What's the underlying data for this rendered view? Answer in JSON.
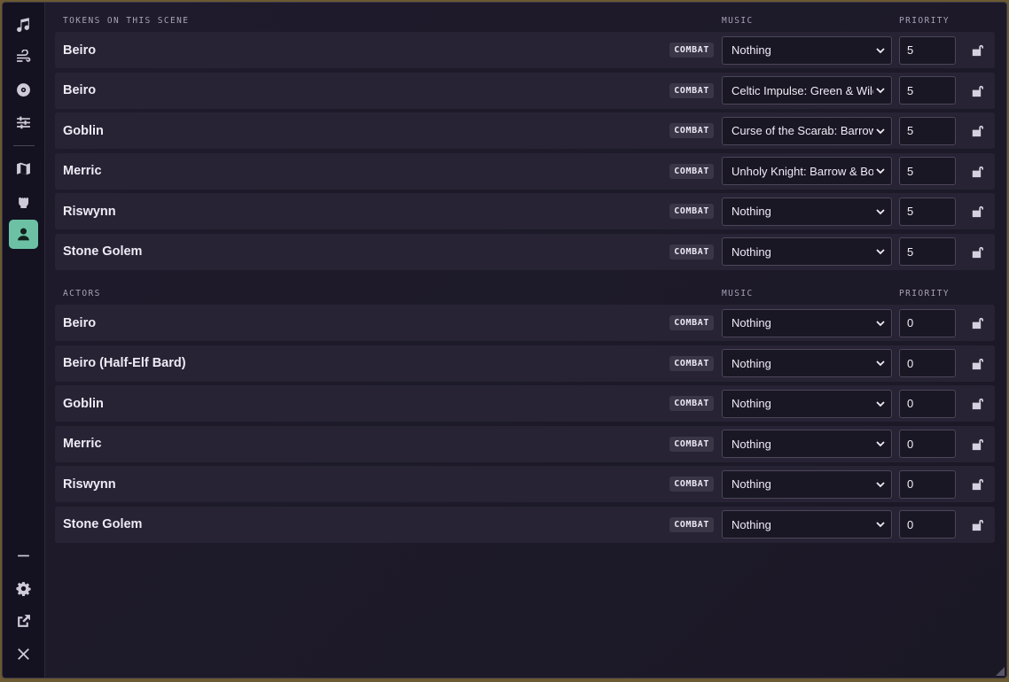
{
  "sidebar": {
    "top_icons": [
      "music-icon",
      "wind-icon",
      "vinyl-icon",
      "sliders-icon"
    ],
    "mid_icons": [
      "map-icon",
      "fist-icon",
      "user-icon"
    ],
    "active": "user-icon",
    "bottom_icons": [
      "minimize-icon",
      "gear-icon",
      "external-link-icon",
      "close-icon"
    ]
  },
  "sections": [
    {
      "title": "TOKENS ON THIS SCENE",
      "music_header": "MUSIC",
      "priority_header": "PRIORITY",
      "rows": [
        {
          "name": "Beiro",
          "badge": "COMBAT",
          "music": "Nothing",
          "priority": "5"
        },
        {
          "name": "Beiro",
          "badge": "COMBAT",
          "music": "Celtic Impulse: Green & Wild",
          "priority": "5"
        },
        {
          "name": "Goblin",
          "badge": "COMBAT",
          "music": "Curse of the Scarab: Barrow",
          "priority": "5"
        },
        {
          "name": "Merric",
          "badge": "COMBAT",
          "music": "Unholy Knight: Barrow & Bo",
          "priority": "5"
        },
        {
          "name": "Riswynn",
          "badge": "COMBAT",
          "music": "Nothing",
          "priority": "5"
        },
        {
          "name": "Stone Golem",
          "badge": "COMBAT",
          "music": "Nothing",
          "priority": "5"
        }
      ]
    },
    {
      "title": "ACTORS",
      "music_header": "MUSIC",
      "priority_header": "PRIORITY",
      "rows": [
        {
          "name": "Beiro",
          "badge": "COMBAT",
          "music": "Nothing",
          "priority": "0"
        },
        {
          "name": "Beiro (Half-Elf Bard)",
          "badge": "COMBAT",
          "music": "Nothing",
          "priority": "0"
        },
        {
          "name": "Goblin",
          "badge": "COMBAT",
          "music": "Nothing",
          "priority": "0"
        },
        {
          "name": "Merric",
          "badge": "COMBAT",
          "music": "Nothing",
          "priority": "0"
        },
        {
          "name": "Riswynn",
          "badge": "COMBAT",
          "music": "Nothing",
          "priority": "0"
        },
        {
          "name": "Stone Golem",
          "badge": "COMBAT",
          "music": "Nothing",
          "priority": "0"
        }
      ]
    }
  ],
  "colors": {
    "accent": "#6cc1a5",
    "background": "#1d1a29",
    "row": "#272335"
  }
}
